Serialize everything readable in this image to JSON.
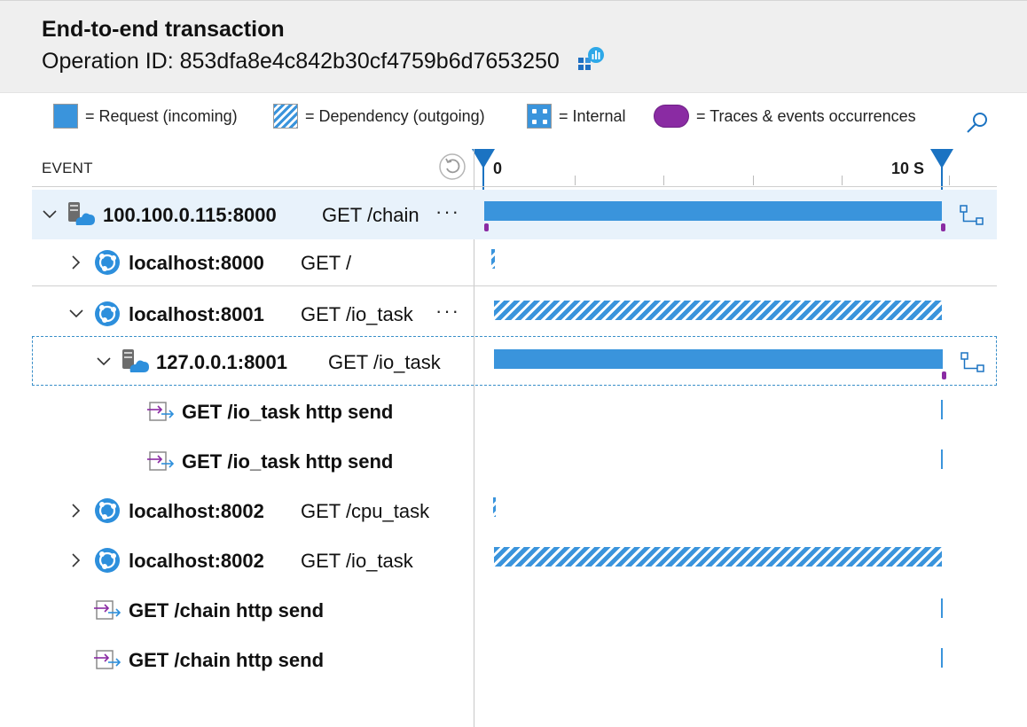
{
  "header": {
    "title": "End-to-end transaction",
    "operation_label": "Operation ID: 853dfa8e4c842b30cf4759b6d7653250",
    "app_insights_icon": "app-insights-icon"
  },
  "legend": {
    "request": "= Request (incoming)",
    "dependency": "= Dependency (outgoing)",
    "internal": "= Internal",
    "traces": "= Traces & events occurrences",
    "search_icon": "search-icon"
  },
  "columns": {
    "event": "EVENT"
  },
  "timeline": {
    "start_label": "0",
    "end_label": "10 S"
  },
  "colors": {
    "request": "#3a94dc",
    "trace": "#8a2ba3",
    "marker": "#1b73c2"
  },
  "rows": [
    {
      "name": "100.100.0.115:8000",
      "operation": "GET /chain",
      "more": "···",
      "type": "request",
      "icon": "server-cloud-icon",
      "expanded": true
    },
    {
      "name": "localhost:8000",
      "operation": "GET /",
      "type": "dependency",
      "icon": "globe-icon",
      "expanded": false
    },
    {
      "name": "localhost:8001",
      "operation": "GET /io_task",
      "more": "···",
      "type": "dependency",
      "icon": "globe-icon",
      "expanded": true
    },
    {
      "name": "127.0.0.1:8001",
      "operation": "GET /io_task",
      "type": "request",
      "icon": "server-cloud-icon",
      "expanded": true
    },
    {
      "name": "GET /io_task http send",
      "type": "internal",
      "icon": "http-send-icon"
    },
    {
      "name": "GET /io_task http send",
      "type": "internal",
      "icon": "http-send-icon"
    },
    {
      "name": "localhost:8002",
      "operation": "GET /cpu_task",
      "type": "dependency",
      "icon": "globe-icon",
      "expanded": false
    },
    {
      "name": "localhost:8002",
      "operation": "GET /io_task",
      "type": "dependency",
      "icon": "globe-icon",
      "expanded": false
    },
    {
      "name": "GET /chain http send",
      "type": "internal",
      "icon": "http-send-icon"
    },
    {
      "name": "GET /chain http send",
      "type": "internal",
      "icon": "http-send-icon"
    }
  ]
}
